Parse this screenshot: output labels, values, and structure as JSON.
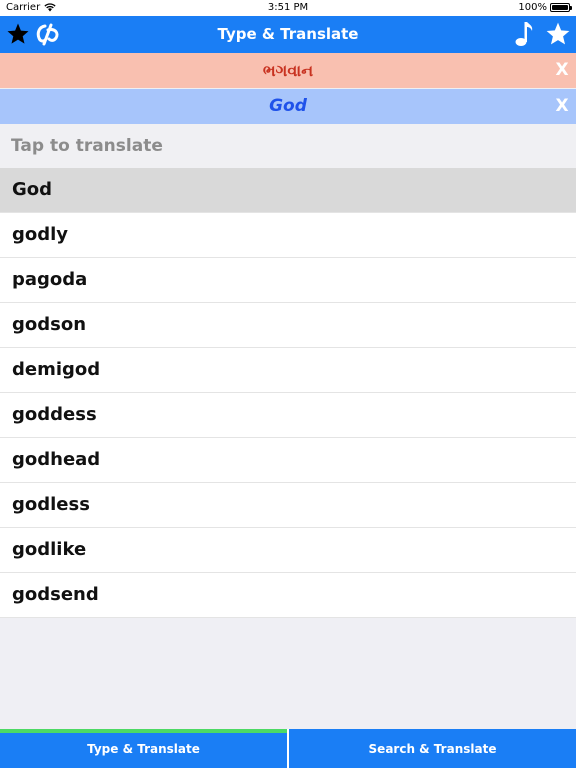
{
  "status_bar": {
    "carrier": "Carrier",
    "time": "3:51 PM",
    "battery": "100%",
    "battery_level": 1.0
  },
  "nav": {
    "title": "Type & Translate",
    "left_icons": [
      "star-icon",
      "app-logo-icon"
    ],
    "right_icons": [
      "music-note-icon",
      "star-icon"
    ]
  },
  "source": {
    "text": "ભગવાન",
    "close": "X"
  },
  "target": {
    "text": "God",
    "close": "X"
  },
  "search": {
    "placeholder": "Tap to translate",
    "value": ""
  },
  "results": [
    "God",
    "godly",
    "pagoda",
    "godson",
    "demigod",
    "goddess",
    "godhead",
    "godless",
    "godlike",
    "godsend"
  ],
  "selected_index": 0,
  "tabs": [
    {
      "label": "Type & Translate",
      "active": true
    },
    {
      "label": "Search & Translate",
      "active": false
    }
  ],
  "colors": {
    "nav_blue": "#1a7ef5",
    "source_bg": "#f9c0b0",
    "source_text": "#c83220",
    "target_bg": "#a7c5fb",
    "target_text": "#1f52ea",
    "tab_active_indicator": "#4cd964"
  }
}
